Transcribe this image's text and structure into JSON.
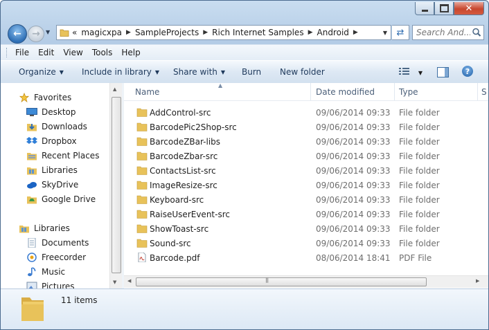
{
  "window": {
    "caption_buttons": [
      "minimize",
      "maximize",
      "close"
    ]
  },
  "address_bar": {
    "overflow": "«",
    "crumbs": [
      "magicxpa",
      "SampleProjects",
      "Rich Internet Samples",
      "Android"
    ]
  },
  "search": {
    "placeholder": "Search And..."
  },
  "menu": {
    "items": [
      "File",
      "Edit",
      "View",
      "Tools",
      "Help"
    ]
  },
  "commands": {
    "organize": "Organize",
    "include": "Include in library",
    "share": "Share with",
    "burn": "Burn",
    "new_folder": "New folder"
  },
  "nav_pane": {
    "favorites_label": "Favorites",
    "favorites": [
      "Desktop",
      "Downloads",
      "Dropbox",
      "Recent Places",
      "Libraries",
      "SkyDrive",
      "Google Drive"
    ],
    "libraries_label": "Libraries",
    "libraries": [
      "Documents",
      "Freecorder",
      "Music",
      "Pictures"
    ]
  },
  "columns": {
    "name": "Name",
    "date": "Date modified",
    "type": "Type",
    "size": "S"
  },
  "files": [
    {
      "name": "AddControl-src",
      "date": "09/06/2014 09:33",
      "type": "File folder",
      "icon": "folder-icon"
    },
    {
      "name": "BarcodePic2Shop-src",
      "date": "09/06/2014 09:33",
      "type": "File folder",
      "icon": "folder-icon"
    },
    {
      "name": "BarcodeZBar-libs",
      "date": "09/06/2014 09:33",
      "type": "File folder",
      "icon": "folder-icon"
    },
    {
      "name": "BarcodeZbar-src",
      "date": "09/06/2014 09:33",
      "type": "File folder",
      "icon": "folder-icon"
    },
    {
      "name": "ContactsList-src",
      "date": "09/06/2014 09:33",
      "type": "File folder",
      "icon": "folder-icon"
    },
    {
      "name": "ImageResize-src",
      "date": "09/06/2014 09:33",
      "type": "File folder",
      "icon": "folder-icon"
    },
    {
      "name": "Keyboard-src",
      "date": "09/06/2014 09:33",
      "type": "File folder",
      "icon": "folder-icon"
    },
    {
      "name": "RaiseUserEvent-src",
      "date": "09/06/2014 09:33",
      "type": "File folder",
      "icon": "folder-icon"
    },
    {
      "name": "ShowToast-src",
      "date": "09/06/2014 09:33",
      "type": "File folder",
      "icon": "folder-icon"
    },
    {
      "name": "Sound-src",
      "date": "09/06/2014 09:33",
      "type": "File folder",
      "icon": "folder-icon"
    },
    {
      "name": "Barcode.pdf",
      "date": "08/06/2014 18:41",
      "type": "PDF File",
      "icon": "pdf-file-icon"
    }
  ],
  "details": {
    "count": "11 items"
  },
  "colors": {
    "folder": "#e8c25a",
    "accent": "#2f6fb5"
  }
}
